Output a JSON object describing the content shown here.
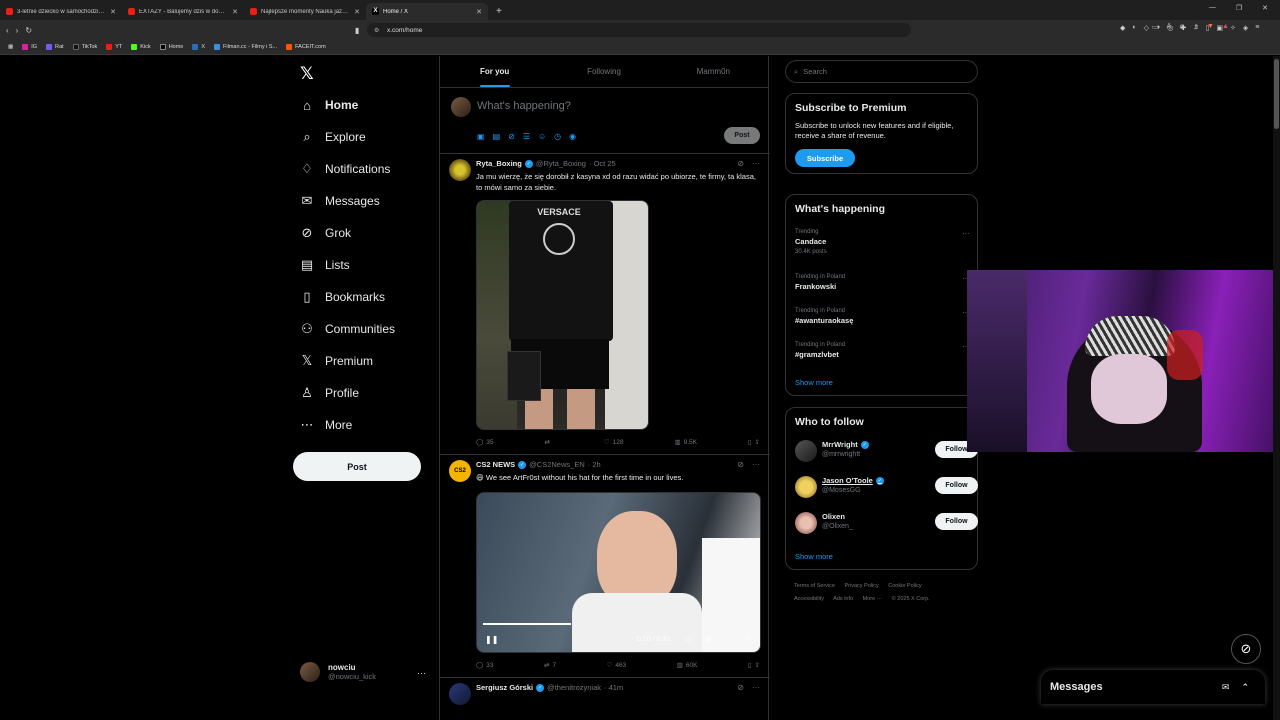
{
  "browser": {
    "tabs": [
      {
        "title": "3-letnie dziecko w samochodzie i po",
        "icon": "youtube-icon",
        "active": false
      },
      {
        "title": "EXTAZY - Balujemy dziś w domu [Off",
        "icon": "youtube-icon",
        "active": false
      },
      {
        "title": "Najlepsze momenty Nauka jazdy 3",
        "icon": "youtube-icon",
        "active": false
      },
      {
        "title": "Home / X",
        "icon": "x-icon",
        "active": true
      }
    ],
    "new_tab": "+",
    "url": "x.com/home",
    "bookmarks": [
      "IG",
      "Rat",
      "TikTok",
      "YT",
      "Kick",
      "Home",
      "X",
      "Filman.cc - Filmy i S...",
      "FACEIT.com"
    ]
  },
  "leftnav": {
    "logo": "𝕏",
    "items": [
      {
        "label": "Home",
        "icon": "home-icon"
      },
      {
        "label": "Explore",
        "icon": "search-icon"
      },
      {
        "label": "Notifications",
        "icon": "bell-icon"
      },
      {
        "label": "Messages",
        "icon": "mail-icon"
      },
      {
        "label": "Grok",
        "icon": "grok-icon"
      },
      {
        "label": "Lists",
        "icon": "list-icon"
      },
      {
        "label": "Bookmarks",
        "icon": "bookmark-icon"
      },
      {
        "label": "Communities",
        "icon": "people-icon"
      },
      {
        "label": "Premium",
        "icon": "x-icon"
      },
      {
        "label": "Profile",
        "icon": "user-icon"
      },
      {
        "label": "More",
        "icon": "more-circle-icon"
      }
    ],
    "post_label": "Post",
    "account": {
      "name": "nowciu",
      "handle": "@nowciu_kick",
      "more": "···"
    }
  },
  "timeline": {
    "tabs": [
      "For you",
      "Following",
      "Mamm0n"
    ],
    "active_tab": "For you",
    "compose": {
      "placeholder": "What's happening?",
      "post_label": "Post"
    },
    "tweets": [
      {
        "name": "Ryta_Boxing",
        "handle": "@Ryta_Boxing",
        "time": "· Oct 25",
        "text": "Ja mu wierzę, że się dorobił z kasyna xd od razu widać po ubiorze, te firmy, ta klasa, to mówi samo za siebie.",
        "media_text": "VERSACE",
        "replies": "35",
        "reposts": "",
        "likes": "128",
        "views": "9.5K"
      },
      {
        "name": "CS2 NEWS",
        "handle": "@CS2News_EN",
        "time": "· 2h",
        "text": "😄 We see ArtFr0st without his hat for the first time in our lives.",
        "video_time": "0:10 / 0:31",
        "replies": "33",
        "reposts": "7",
        "likes": "463",
        "views": "60K"
      },
      {
        "name": "Sergiusz Górski",
        "handle": "@thenitrozyniak",
        "time": "· 41m"
      }
    ]
  },
  "sidebar": {
    "search_placeholder": "Search",
    "premium": {
      "title": "Subscribe to Premium",
      "text": "Subscribe to unlock new features and if eligible, receive a share of revenue.",
      "button": "Subscribe"
    },
    "happening": {
      "title": "What's happening",
      "trends": [
        {
          "context": "Trending",
          "name": "Candace",
          "count": "30.4K posts"
        },
        {
          "context": "Trending in Poland",
          "name": "Frankowski",
          "count": ""
        },
        {
          "context": "Trending in Poland",
          "name": "#awanturaokasę",
          "count": ""
        },
        {
          "context": "Trending in Poland",
          "name": "#gramzlvbet",
          "count": ""
        }
      ],
      "show_more": "Show more"
    },
    "who_to_follow": {
      "title": "Who to follow",
      "accounts": [
        {
          "name": "MrrWright",
          "handle": "@mrrwrightt",
          "button": "Follow"
        },
        {
          "name": "Jason O'Toole",
          "handle": "@MosesGG",
          "button": "Follow"
        },
        {
          "name": "Olixen",
          "handle": "@Olixen_",
          "button": "Follow"
        }
      ],
      "show_more": "Show more"
    },
    "footer": [
      "Terms of Service",
      "Privacy Policy",
      "Cookie Policy",
      "Accessibility",
      "Ads info",
      "More ···",
      "© 2025 X Corp."
    ]
  },
  "messages_drawer": {
    "title": "Messages"
  },
  "colors": {
    "accent": "#1d9bf0",
    "background": "#000000",
    "border": "#2f3336",
    "muted": "#71767b"
  }
}
